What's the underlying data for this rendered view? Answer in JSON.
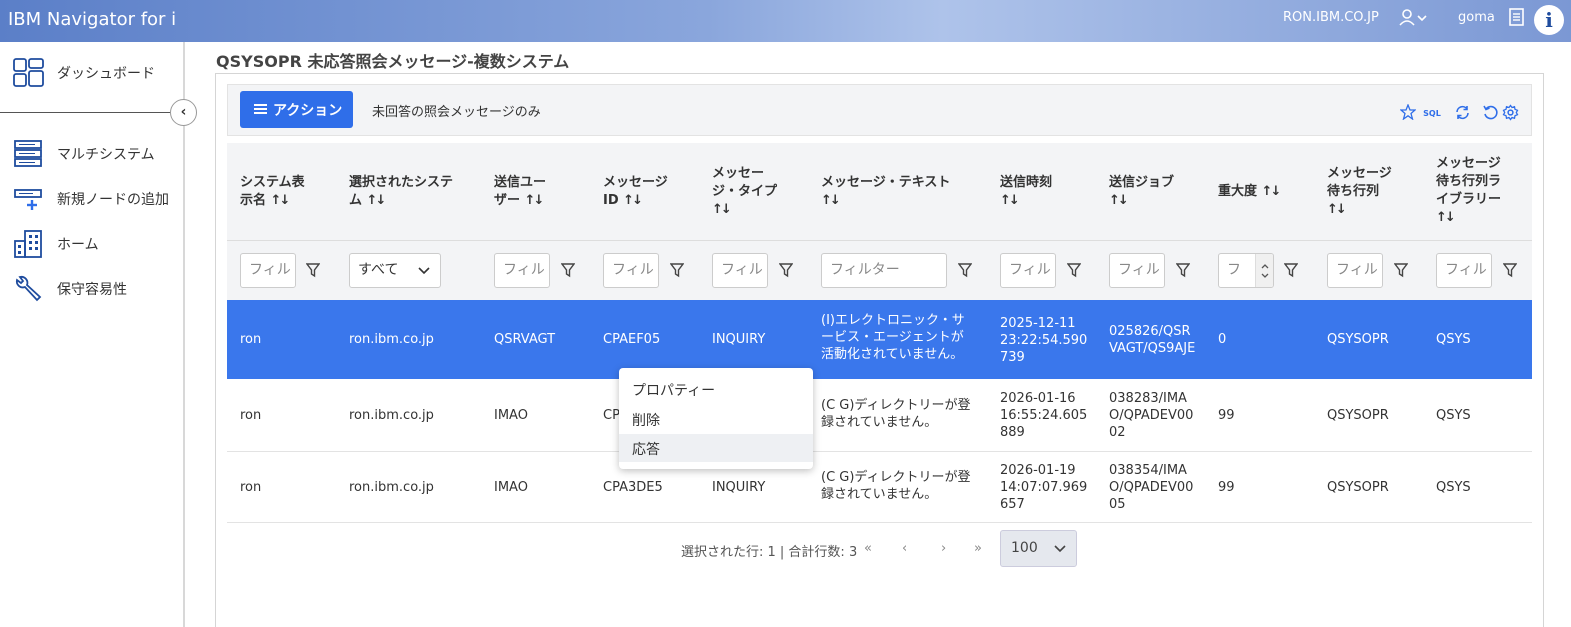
{
  "header": {
    "app_title": "IBM Navigator for i",
    "host": "RON.IBM.CO.JP",
    "user": "goma",
    "logo_letter": "i"
  },
  "sidebar": {
    "items": [
      {
        "label": "ダッシュボード",
        "icon": "dashboard-icon"
      },
      {
        "label": "マルチシステム",
        "icon": "server-stack-icon"
      },
      {
        "label": "新規ノードの追加",
        "icon": "add-node-icon"
      },
      {
        "label": "ホーム",
        "icon": "building-icon"
      },
      {
        "label": "保守容易性",
        "icon": "wrench-icon"
      }
    ],
    "collapse_glyph": "‹"
  },
  "page": {
    "title": "QSYSOPR 未応答照会メッセージ-複数システム"
  },
  "toolbar": {
    "action_label": "アクション",
    "filter_note": "未回答の照会メッセージのみ",
    "icons": [
      "star-icon",
      "sql-icon",
      "refresh-icon",
      "reset-icon",
      "settings-icon"
    ],
    "sql_text": "SQL"
  },
  "table": {
    "columns": [
      {
        "l1": "システム表",
        "l2": "示名",
        "sort": "↑↓"
      },
      {
        "l1": "選択されたシステ",
        "l2": "ム",
        "sort": "↑↓"
      },
      {
        "l1": "送信ユー",
        "l2": "ザー",
        "sort": "↑↓"
      },
      {
        "l1": "メッセージ",
        "l2": "ID",
        "sort": "↑↓"
      },
      {
        "l1": "メッセー",
        "l2": "ジ・タイプ",
        "l3": "↑↓"
      },
      {
        "l1": "メッセージ・テキスト",
        "l2": "↑↓"
      },
      {
        "l1": "送信時刻",
        "l2": "↑↓"
      },
      {
        "l1": "送信ジョブ",
        "l2": "↑↓"
      },
      {
        "l1": "重大度",
        "sort": "↑↓"
      },
      {
        "l1": "メッセージ",
        "l2": "待ち行列",
        "l3": "↑↓"
      },
      {
        "l1": "メッセージ",
        "l2": "待ち行列ラ",
        "l3": "イブラリー",
        "l4": "↑↓"
      }
    ],
    "filters": {
      "placeholder_short": "フィル",
      "placeholder_text": "フィルター",
      "system_select": "すべて",
      "severity_short": "フ"
    },
    "rows": [
      {
        "sys": "ron",
        "selected": "ron.ibm.co.jp",
        "user": "QSRVAGT",
        "msgid": "CPAEF05",
        "type": "INQUIRY",
        "text": [
          "(I)エレクトロニック・サ",
          "ービス・エージェントが",
          "活動化されていません。"
        ],
        "time": [
          "2025-12-11",
          "23:22:54.590",
          "739"
        ],
        "job": [
          "025826/QSR",
          "VAGT/QS9AJE"
        ],
        "sev": "0",
        "queue": "QSYSOPR",
        "lib": "QSYS"
      },
      {
        "sys": "ron",
        "selected": "ron.ibm.co.jp",
        "user": "IMAO",
        "msgid": "CP",
        "type": "",
        "text": [
          "(C G)ディレクトリーが登",
          "録されていません。"
        ],
        "time": [
          "2026-01-16",
          "16:55:24.605",
          "889"
        ],
        "job": [
          "038283/IMA",
          "O/QPADEV00",
          "02"
        ],
        "sev": "99",
        "queue": "QSYSOPR",
        "lib": "QSYS"
      },
      {
        "sys": "ron",
        "selected": "ron.ibm.co.jp",
        "user": "IMAO",
        "msgid": "CPA3DE5",
        "type": "INQUIRY",
        "text": [
          "(C G)ディレクトリーが登",
          "録されていません。"
        ],
        "time": [
          "2026-01-19",
          "14:07:07.969",
          "657"
        ],
        "job": [
          "038354/IMA",
          "O/QPADEV00",
          "05"
        ],
        "sev": "99",
        "queue": "QSYSOPR",
        "lib": "QSYS"
      }
    ]
  },
  "pager": {
    "summary": "選択された行: 1 | 合計行数: 3",
    "first": "«",
    "prev": "‹",
    "next": "›",
    "last": "»",
    "page_size": "100"
  },
  "context_menu": {
    "items": [
      "プロパティー",
      "削除",
      "応答"
    ]
  }
}
